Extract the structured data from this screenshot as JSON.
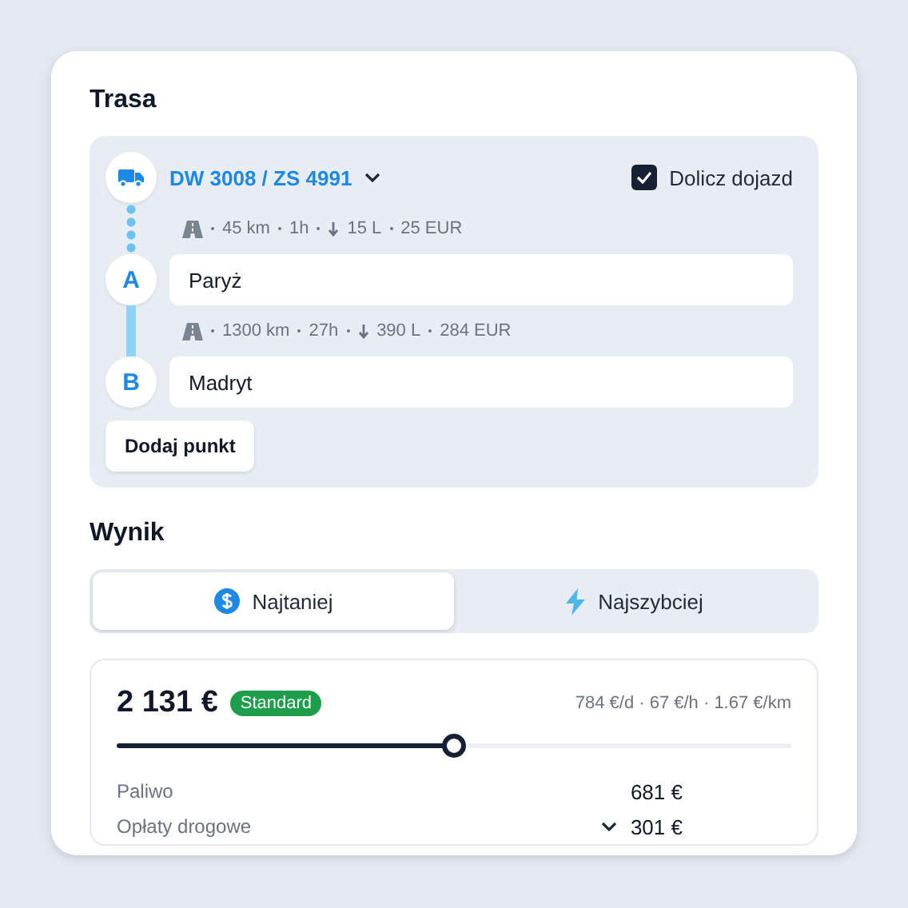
{
  "route_section": {
    "title": "Trasa",
    "vehicle": {
      "label": "DW 3008 / ZS 4991"
    },
    "include_approach": {
      "label": "Dolicz dojazd",
      "checked": true
    },
    "legs": [
      {
        "kind": "approach",
        "distance": "45 km",
        "time": "1h",
        "fuel": "15 L",
        "cost": "25 EUR"
      },
      {
        "kind": "route",
        "distance": "1300 km",
        "time": "27h",
        "fuel": "390 L",
        "cost": "284 EUR"
      }
    ],
    "points": [
      {
        "marker": "A",
        "value": "Paryż"
      },
      {
        "marker": "B",
        "value": "Madryt"
      }
    ],
    "add_button": "Dodaj punkt"
  },
  "result_section": {
    "title": "Wynik",
    "tabs": [
      {
        "kind": "cheapest",
        "label": "Najtaniej",
        "selected": true
      },
      {
        "kind": "fastest",
        "label": "Najszybciej",
        "selected": false
      }
    ],
    "total": "2 131 €",
    "badge": "Standard",
    "rates": "784 €/d · 67 €/h · 1.67 €/km",
    "slider": {
      "level": 0.5
    },
    "rows": [
      {
        "label": "Paliwo",
        "value": "681 €",
        "expandable": false
      },
      {
        "label": "Opłaty drogowe",
        "value": "301 €",
        "expandable": true
      }
    ]
  }
}
